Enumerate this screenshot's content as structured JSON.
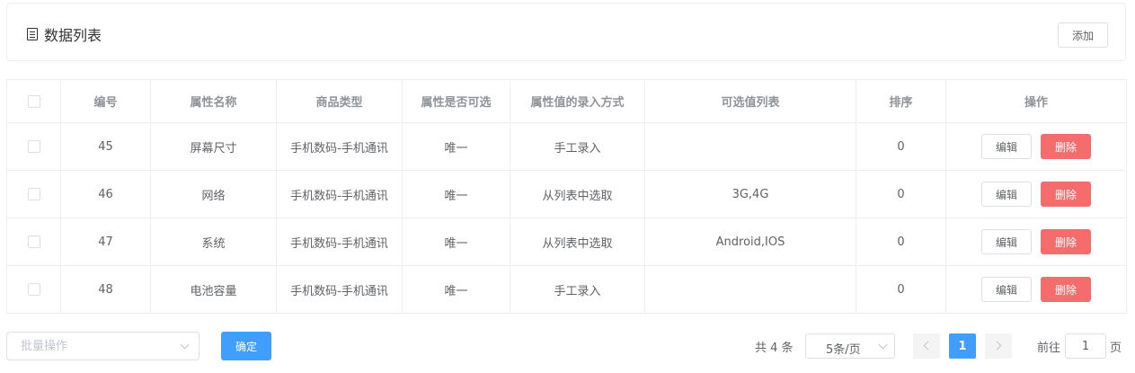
{
  "header": {
    "title": "数据列表",
    "add_label": "添加"
  },
  "table": {
    "columns": [
      "编号",
      "属性名称",
      "商品类型",
      "属性是否可选",
      "属性值的录入方式",
      "可选值列表",
      "排序",
      "操作"
    ],
    "rows": [
      {
        "id": "45",
        "name": "屏幕尺寸",
        "type": "手机数码-手机通讯",
        "selectable": "唯一",
        "input_mode": "手工录入",
        "values": "",
        "sort": "0",
        "edit": "编辑",
        "delete": "删除"
      },
      {
        "id": "46",
        "name": "网络",
        "type": "手机数码-手机通讯",
        "selectable": "唯一",
        "input_mode": "从列表中选取",
        "values": "3G,4G",
        "sort": "0",
        "edit": "编辑",
        "delete": "删除"
      },
      {
        "id": "47",
        "name": "系统",
        "type": "手机数码-手机通讯",
        "selectable": "唯一",
        "input_mode": "从列表中选取",
        "values": "Android,IOS",
        "sort": "0",
        "edit": "编辑",
        "delete": "删除"
      },
      {
        "id": "48",
        "name": "电池容量",
        "type": "手机数码-手机通讯",
        "selectable": "唯一",
        "input_mode": "手工录入",
        "values": "",
        "sort": "0",
        "edit": "编辑",
        "delete": "删除"
      }
    ]
  },
  "footer": {
    "batch_placeholder": "批量操作",
    "confirm_label": "确定",
    "total_text": "共 4 条",
    "page_size": "5条/页",
    "current_page": "1",
    "goto_prefix": "前往",
    "goto_value": "1",
    "goto_suffix": "页"
  },
  "colors": {
    "primary": "#409eff",
    "danger": "#f56c6c",
    "border": "#ebeef5"
  },
  "icons": [
    "list-icon",
    "chevron-down-icon",
    "chevron-left-icon",
    "chevron-right-icon"
  ]
}
